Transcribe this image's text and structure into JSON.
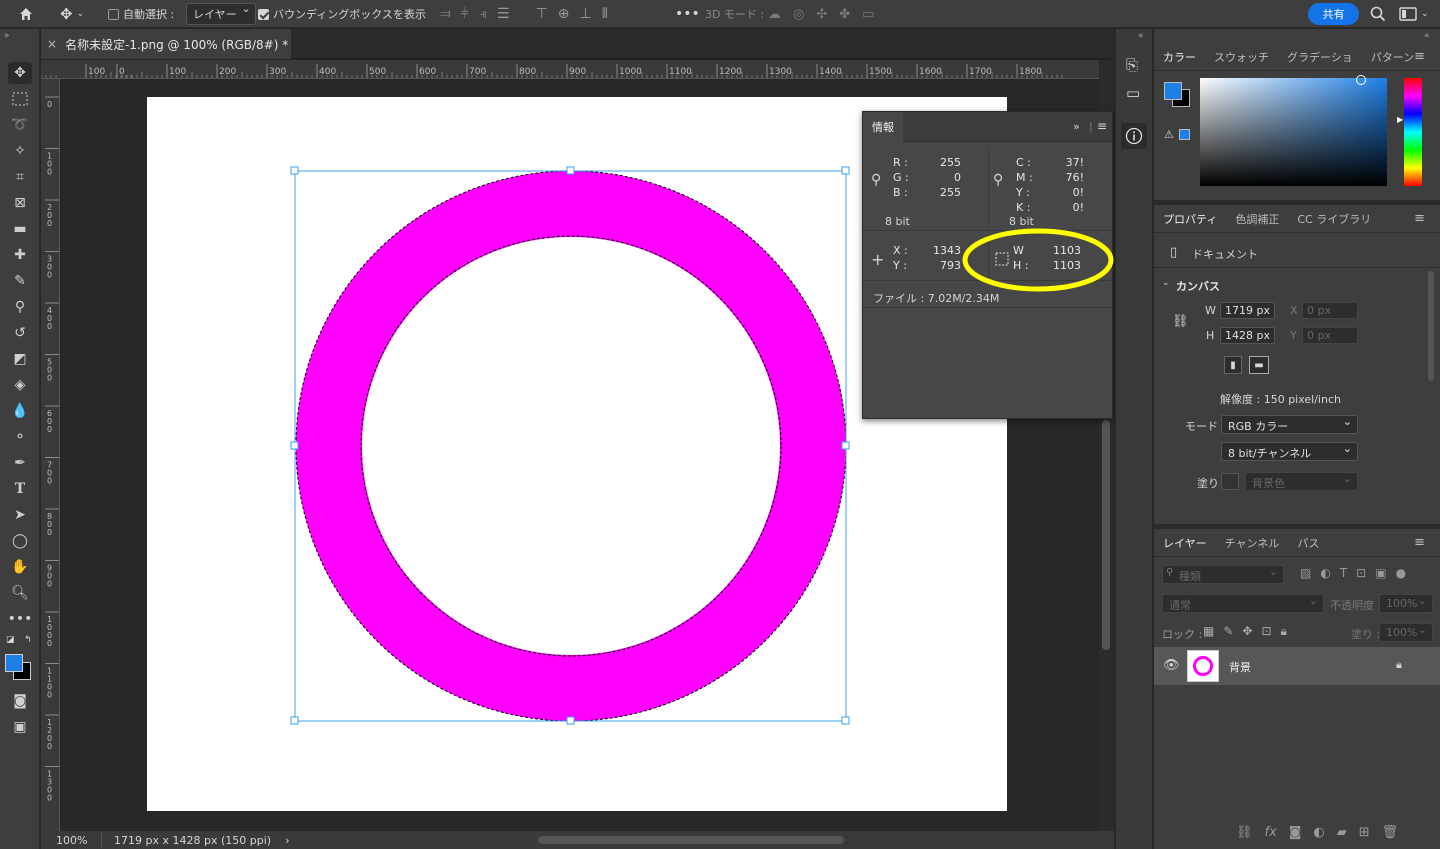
{
  "options_bar": {
    "auto_select_label": "自動選択 :",
    "auto_select_target": "レイヤー",
    "bounding_box_label": "バウンディングボックスを表示",
    "mode_3d_label": "3D モード :",
    "share_label": "共有"
  },
  "document": {
    "tab_title": "名称未設定-1.png @ 100% (RGB/8#) *",
    "zoom": "100%",
    "status": "1719 px x 1428 px (150 ppi)"
  },
  "rulers": {
    "horizontal": [
      "0",
      "100",
      "0",
      "100",
      "200",
      "300",
      "400",
      "500",
      "600",
      "700",
      "800",
      "900",
      "1000",
      "1100",
      "1200",
      "1300",
      "1400",
      "1500",
      "1600",
      "1700",
      "1800"
    ],
    "vertical": [
      "0",
      "100",
      "200",
      "300",
      "400",
      "500",
      "600",
      "700",
      "800",
      "900",
      "1000",
      "1100",
      "1200",
      "1300"
    ]
  },
  "shape": {
    "fill_color": "#ff00ff",
    "stroke_outer_diameter_px": 1103
  },
  "info_panel": {
    "title": "情報",
    "rgb": [
      {
        "k": "R :",
        "v": "255"
      },
      {
        "k": "G :",
        "v": "0"
      },
      {
        "k": "B :",
        "v": "255"
      }
    ],
    "cmyk": [
      {
        "k": "C :",
        "v": "37!"
      },
      {
        "k": "M :",
        "v": "76!"
      },
      {
        "k": "Y :",
        "v": "0!"
      },
      {
        "k": "K :",
        "v": "0!"
      }
    ],
    "bit_left": "8 bit",
    "bit_right": "8 bit",
    "pos": [
      {
        "k": "X :",
        "v": "1343"
      },
      {
        "k": "Y :",
        "v": "793"
      }
    ],
    "size": [
      {
        "k": "W :",
        "v": "1103"
      },
      {
        "k": "H :",
        "v": "1103"
      }
    ],
    "file": "ファイル : 7.02M/2.34M"
  },
  "color_panel": {
    "tabs": [
      "カラー",
      "スウォッチ",
      "グラデーショ",
      "パターン"
    ],
    "foreground": "#1e7fe6",
    "background": "#000000"
  },
  "properties_panel": {
    "tabs": [
      "プロパティ",
      "色調補正",
      "CC ライブラリ"
    ],
    "doc_label": "ドキュメント",
    "canvas_label": "カンバス",
    "w_label": "W",
    "w_value": "1719 px",
    "h_label": "H",
    "h_value": "1428 px",
    "x_label": "X",
    "x_value": "0 px",
    "y_label": "Y",
    "y_value": "0 px",
    "resolution": "解像度 : 150 pixel/inch",
    "mode_label": "モード",
    "mode_value": "RGB カラー",
    "bits_value": "8 bit/チャンネル",
    "fill_label": "塗り",
    "fill_value": "背景色"
  },
  "layers_panel": {
    "tabs": [
      "レイヤー",
      "チャンネル",
      "パス"
    ],
    "search_placeholder": "種類",
    "blend_mode": "通常",
    "opacity_label": "不透明度 :",
    "opacity_value": "100%",
    "lock_label": "ロック :",
    "fill_label": "塗り :",
    "fill_value": "100%",
    "layer_name": "背景"
  }
}
